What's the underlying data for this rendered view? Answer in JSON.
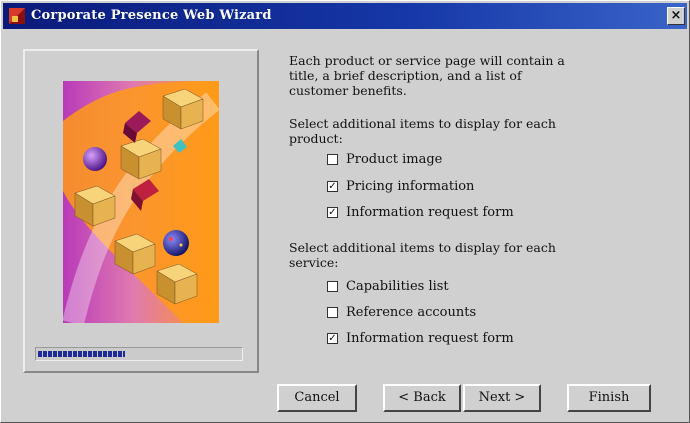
{
  "window": {
    "title": "Corporate Presence Web Wizard",
    "close_glyph": "×"
  },
  "intro": "Each product or service page will contain a\ntitle, a brief description, and a list of\ncustomer benefits.",
  "product_prompt": "Select additional items to display for each\nproduct:",
  "product_options": [
    {
      "label": "Product image",
      "checked": false
    },
    {
      "label": "Pricing information",
      "checked": true
    },
    {
      "label": "Information request form",
      "checked": true
    }
  ],
  "service_prompt": "Select additional items to display for each\nservice:",
  "service_options": [
    {
      "label": "Capabilities list",
      "checked": false
    },
    {
      "label": "Reference accounts",
      "checked": false
    },
    {
      "label": "Information request form",
      "checked": true
    }
  ],
  "progress": {
    "fraction": 0.43
  },
  "buttons": {
    "cancel": "Cancel",
    "back": "< Back",
    "next": "Next >",
    "finish": "Finish"
  },
  "check_glyph": "✓",
  "colors": {
    "titlebar": "#0a1a7a",
    "face": "#d0d0d0",
    "progress": "#1c2a9a"
  }
}
